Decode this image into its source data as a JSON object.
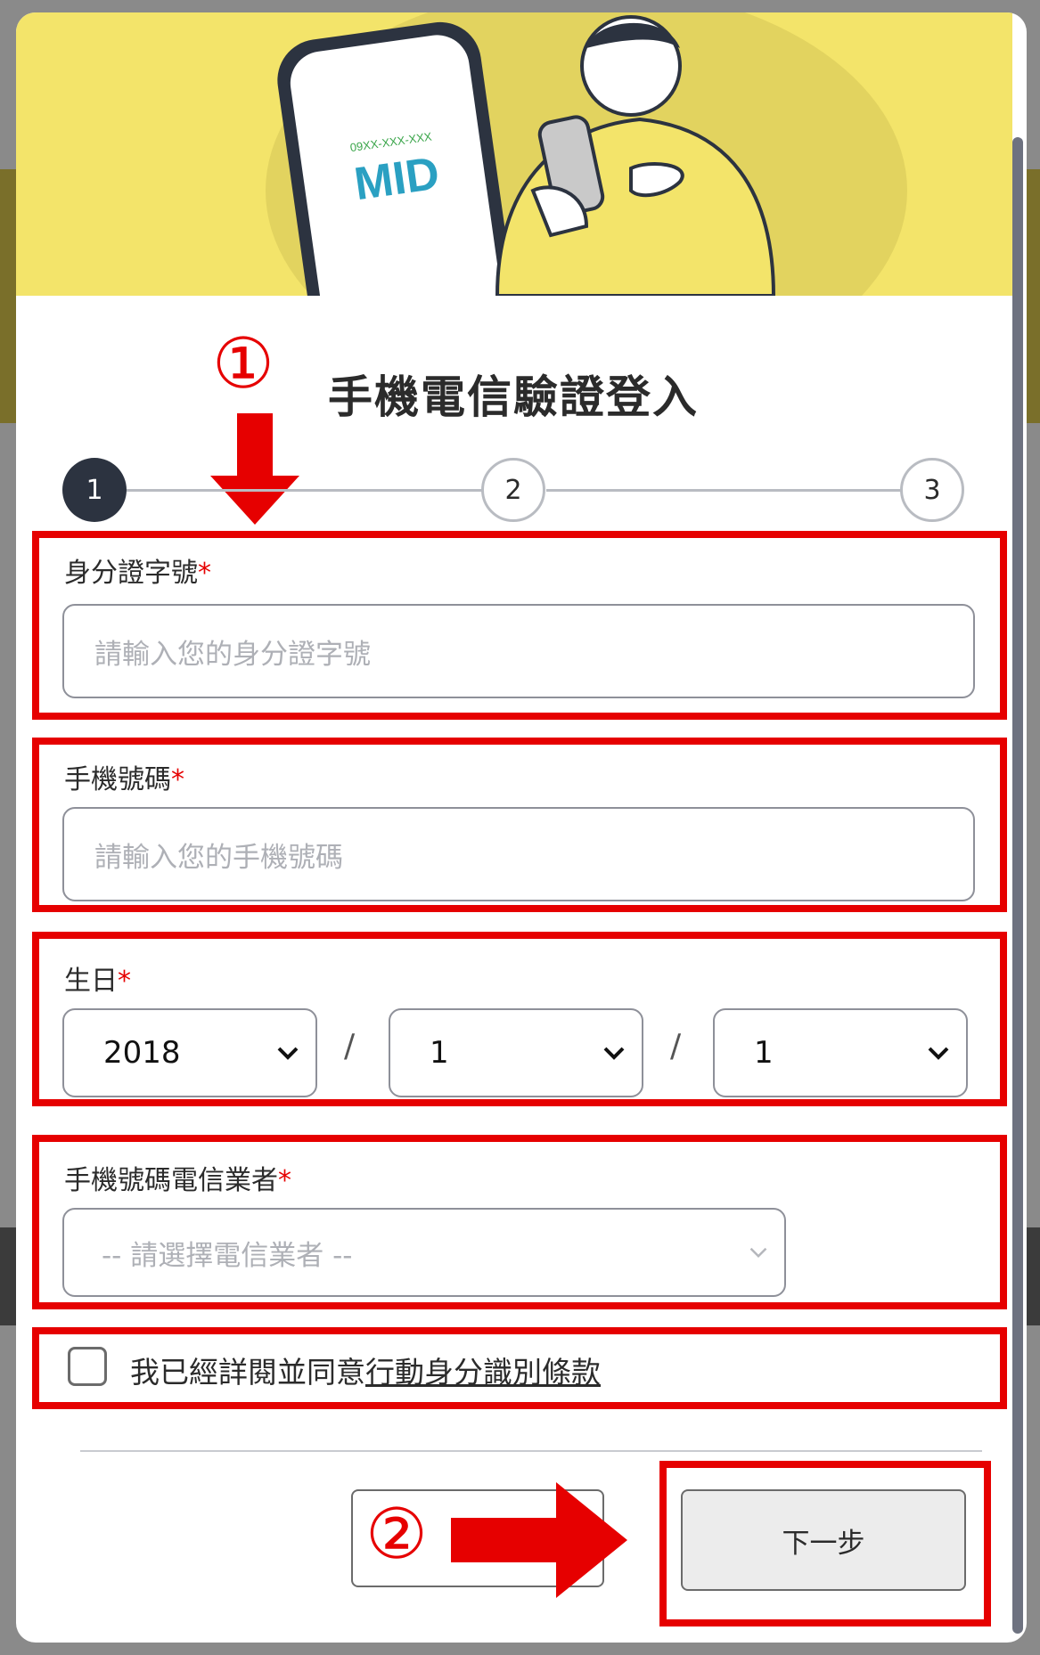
{
  "modal": {
    "title": "手機電信驗證登入"
  },
  "hero": {
    "phone_number_mask": "09XX-XXX-XXX",
    "logo_text": "MID"
  },
  "annotations": {
    "step_one_marker": "①",
    "step_two_marker": "②"
  },
  "stepper": {
    "steps": [
      "1",
      "2",
      "3"
    ],
    "current_step": 1
  },
  "form": {
    "id_number": {
      "label": "身分證字號",
      "required_mark": "*",
      "placeholder": "請輸入您的身分證字號"
    },
    "phone": {
      "label": "手機號碼",
      "required_mark": "*",
      "placeholder": "請輸入您的手機號碼"
    },
    "birthday": {
      "label": "生日",
      "required_mark": "*",
      "year": "2018",
      "month": "1",
      "day": "1",
      "separator": "/"
    },
    "carrier": {
      "label": "手機號碼電信業者",
      "required_mark": "*",
      "placeholder": "-- 請選擇電信業者 --"
    },
    "agreement": {
      "text": "我已經詳閱並同意",
      "link_text": "行動身分識別條款",
      "checked": false
    }
  },
  "buttons": {
    "prev_label": "",
    "next_label": "下一步"
  },
  "colors": {
    "hero_bg": "#f3e46a",
    "active_step": "#2c3340",
    "annotation_red": "#e60000"
  }
}
